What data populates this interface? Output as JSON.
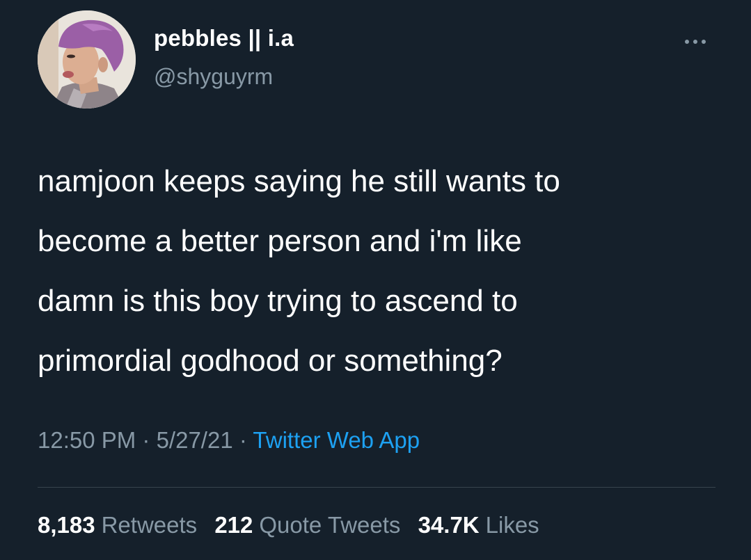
{
  "tweet": {
    "author": {
      "display_name": "pebbles || i.a",
      "handle": "@shyguyrm"
    },
    "text_lines": [
      "namjoon keeps saying he still wants to",
      "become a better person and i'm like",
      "damn is this boy trying to ascend to",
      "primordial godhood or something?"
    ],
    "time": "12:50 PM",
    "date": "5/27/21",
    "separator": " · ",
    "source": "Twitter Web App",
    "stats": {
      "retweets_count": "8,183",
      "retweets_label": "Retweets",
      "quotes_count": "212",
      "quotes_label": "Quote Tweets",
      "likes_count": "34.7K",
      "likes_label": "Likes"
    }
  },
  "icons": {
    "more": "more-horizontal-icon"
  },
  "colors": {
    "background": "#15202b",
    "primary_text": "#ffffff",
    "secondary_text": "#8899a6",
    "link": "#1da1f2",
    "divider": "#38444d"
  }
}
